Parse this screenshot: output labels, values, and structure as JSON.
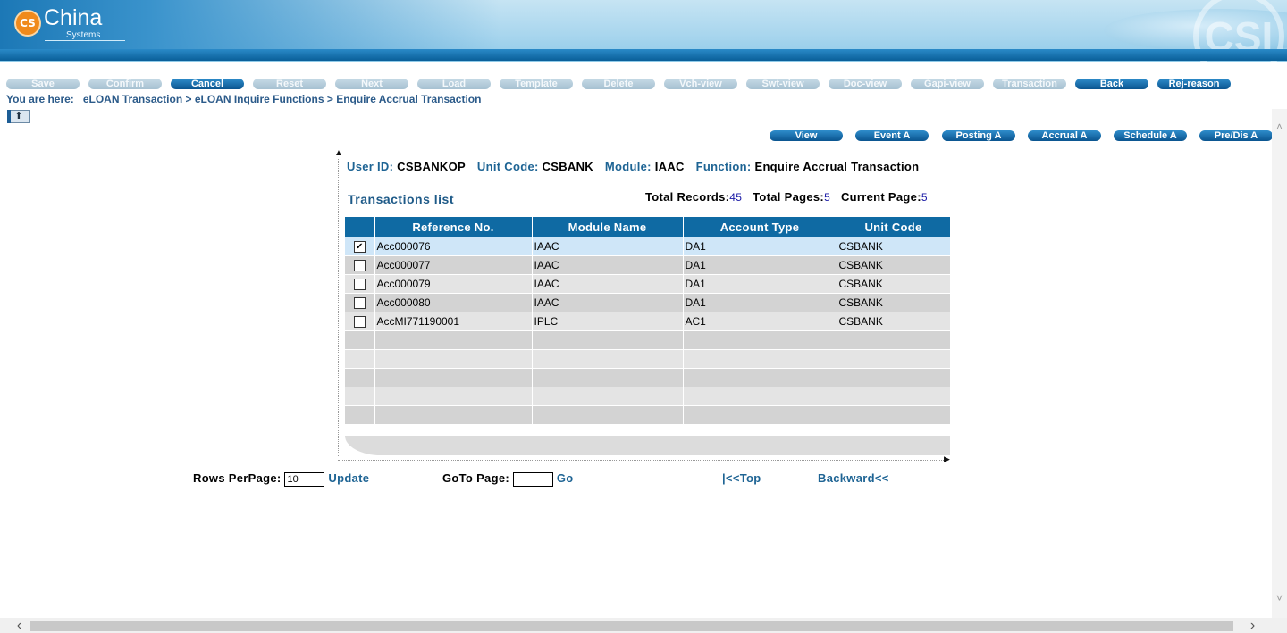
{
  "header": {
    "logo_badge": "CS",
    "logo_name": "China",
    "logo_sub": "Systems",
    "decor_mark": "CSI"
  },
  "toolbar": [
    {
      "label": "Save",
      "state": "disabled"
    },
    {
      "label": "Confirm",
      "state": "disabled"
    },
    {
      "label": "Cancel",
      "state": "active"
    },
    {
      "label": "Reset",
      "state": "disabled"
    },
    {
      "label": "Next",
      "state": "disabled"
    },
    {
      "label": "Load",
      "state": "disabled"
    },
    {
      "label": "Template",
      "state": "disabled"
    },
    {
      "label": "Delete",
      "state": "disabled"
    },
    {
      "label": "Vch-view",
      "state": "disabled"
    },
    {
      "label": "Swt-view",
      "state": "disabled"
    },
    {
      "label": "Doc-view",
      "state": "disabled"
    },
    {
      "label": "Gapi-view",
      "state": "disabled"
    },
    {
      "label": "Transaction",
      "state": "disabled"
    },
    {
      "label": "Back",
      "state": "active"
    },
    {
      "label": "Rej-reason",
      "state": "active"
    }
  ],
  "breadcrumb": {
    "prefix": "You are here:",
    "path": "eLOAN Transaction > eLOAN Inquire Functions > Enquire Accrual Transaction"
  },
  "collapse_icon": "collapse-up-icon",
  "sub_actions": [
    "View",
    "Event A",
    "Posting A",
    "Accrual A",
    "Schedule A",
    "Pre/Dis A"
  ],
  "info": {
    "user_label": "User ID:",
    "user_value": "CSBANKOP",
    "unit_label": "Unit Code:",
    "unit_value": "CSBANK",
    "module_label": "Module:",
    "module_value": "IAAC",
    "function_label": "Function:",
    "function_value": "Enquire Accrual Transaction"
  },
  "list": {
    "title": "Transactions list",
    "total_records_label": "Total Records:",
    "total_records": "45",
    "total_pages_label": "Total Pages:",
    "total_pages": "5",
    "current_page_label": "Current Page:",
    "current_page": "5"
  },
  "table": {
    "columns": [
      "Reference No.",
      "Module Name",
      "Account Type",
      "Unit Code"
    ],
    "rows": [
      {
        "checked": true,
        "ref": "Acc000076",
        "module": "IAAC",
        "account": "DA1",
        "unit": "CSBANK"
      },
      {
        "checked": false,
        "ref": "Acc000077",
        "module": "IAAC",
        "account": "DA1",
        "unit": "CSBANK"
      },
      {
        "checked": false,
        "ref": "Acc000079",
        "module": "IAAC",
        "account": "DA1",
        "unit": "CSBANK"
      },
      {
        "checked": false,
        "ref": "Acc000080",
        "module": "IAAC",
        "account": "DA1",
        "unit": "CSBANK"
      },
      {
        "checked": false,
        "ref": "AccMI771190001",
        "module": "IPLC",
        "account": "AC1",
        "unit": "CSBANK"
      }
    ],
    "empty_rows": 5
  },
  "pager": {
    "rows_label": "Rows PerPage:",
    "rows_value": "10",
    "update_label": "Update",
    "goto_label": "GoTo Page:",
    "goto_value": "",
    "go_label": "Go",
    "top_label": "|<<Top",
    "backward_label": "Backward<<"
  },
  "colors": {
    "accent": "#0f6aa3",
    "label": "#1e6494",
    "selected_row": "#cfe6f8"
  }
}
